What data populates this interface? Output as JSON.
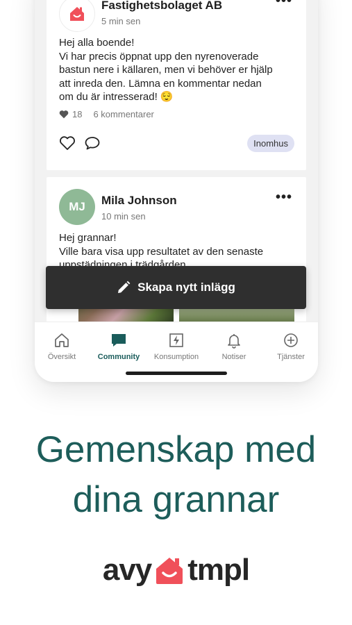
{
  "posts": [
    {
      "author": "Fastighetsbolaget AB",
      "time": "5 min sen",
      "lines": [
        "Hej alla boende!",
        "Vi har precis öppnat upp den nyrenoverade",
        "bastun nere i källaren, men vi behöver er hjälp",
        "att inreda den. Lämna en kommentar nedan",
        "om du är intresserad! 😌"
      ],
      "likes": "18",
      "comments": "6 kommentarer",
      "tag": "Inomhus"
    },
    {
      "author": "Mila Johnson",
      "initials": "MJ",
      "time": "10 min sen",
      "lines": [
        "Hej grannar!",
        "Ville bara visa upp resultatet av den senaste",
        "uppstädningen i trädgården"
      ]
    }
  ],
  "cta": {
    "label": "Skapa nytt inlägg"
  },
  "tabs": [
    {
      "label": "Översikt",
      "icon": "home-icon"
    },
    {
      "label": "Community",
      "icon": "chat-icon",
      "active": true
    },
    {
      "label": "Konsumption",
      "icon": "lightning-icon"
    },
    {
      "label": "Notiser",
      "icon": "bell-icon"
    },
    {
      "label": "Tjänster",
      "icon": "plus-circle-icon"
    }
  ],
  "headline": {
    "line1": "Gemenskap med",
    "line2": "dina grannar"
  },
  "brand": {
    "left": "avy",
    "right": "tmpl",
    "accent": "#f0505a"
  },
  "colors": {
    "primary": "#1d5d5a",
    "cta_bg": "#2f2f2f",
    "tag_bg": "#dfe1f3"
  }
}
